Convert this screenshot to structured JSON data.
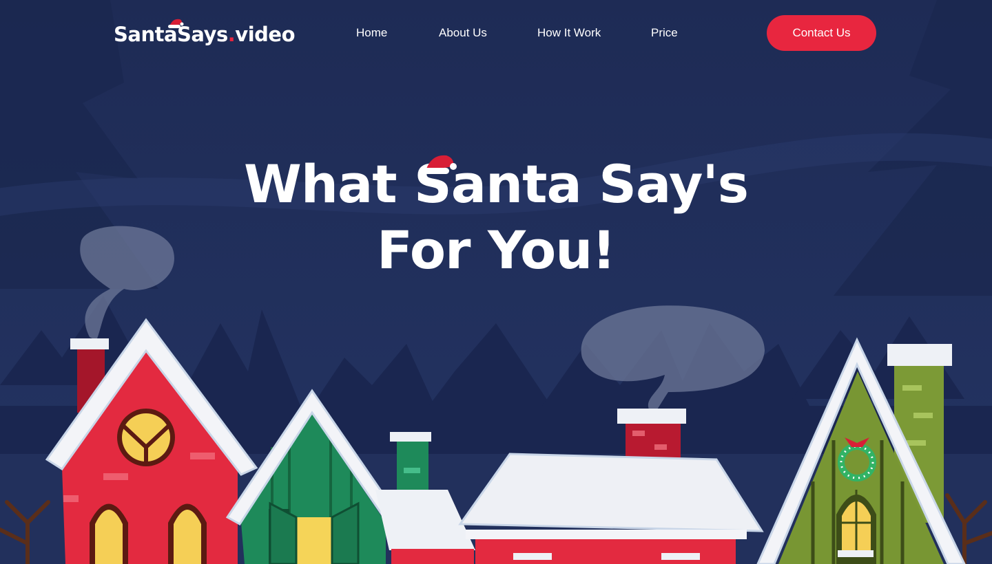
{
  "brand": {
    "logo_main": "SantaSays",
    "logo_dot": ".",
    "logo_suffix": "video"
  },
  "nav": {
    "links": [
      {
        "label": "Home"
      },
      {
        "label": "About Us"
      },
      {
        "label": "How It Work"
      },
      {
        "label": "Price"
      }
    ],
    "cta_label": "Contact Us"
  },
  "hero": {
    "title_line1": "What Santa Say's",
    "title_line2": "For You!"
  },
  "theme": {
    "background": "#1f2d57",
    "accent": "#e8263f",
    "text": "#ffffff"
  },
  "icons": [
    "santa-hat-icon"
  ]
}
